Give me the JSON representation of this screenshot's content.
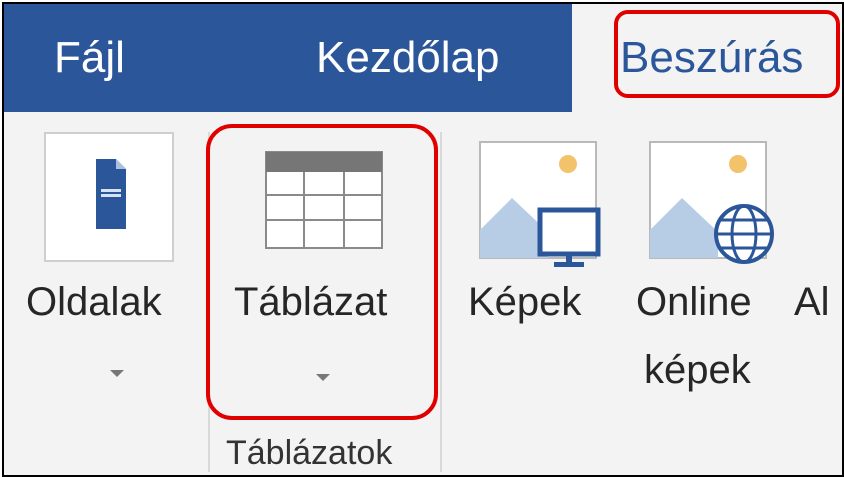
{
  "tabs": {
    "file": "Fájl",
    "home": "Kezdőlap",
    "insert": "Beszúrás"
  },
  "ribbon": {
    "pages_label": "Oldalak",
    "table_label": "Táblázat",
    "pictures_label": "Képek",
    "online_pictures_line1": "Online",
    "online_pictures_line2": "képek",
    "next_partial": "Al",
    "group_tables": "Táblázatok"
  },
  "colors": {
    "tabbar": "#2b579a",
    "highlight": "#e00000",
    "ribbon": "#f3f3f3"
  }
}
